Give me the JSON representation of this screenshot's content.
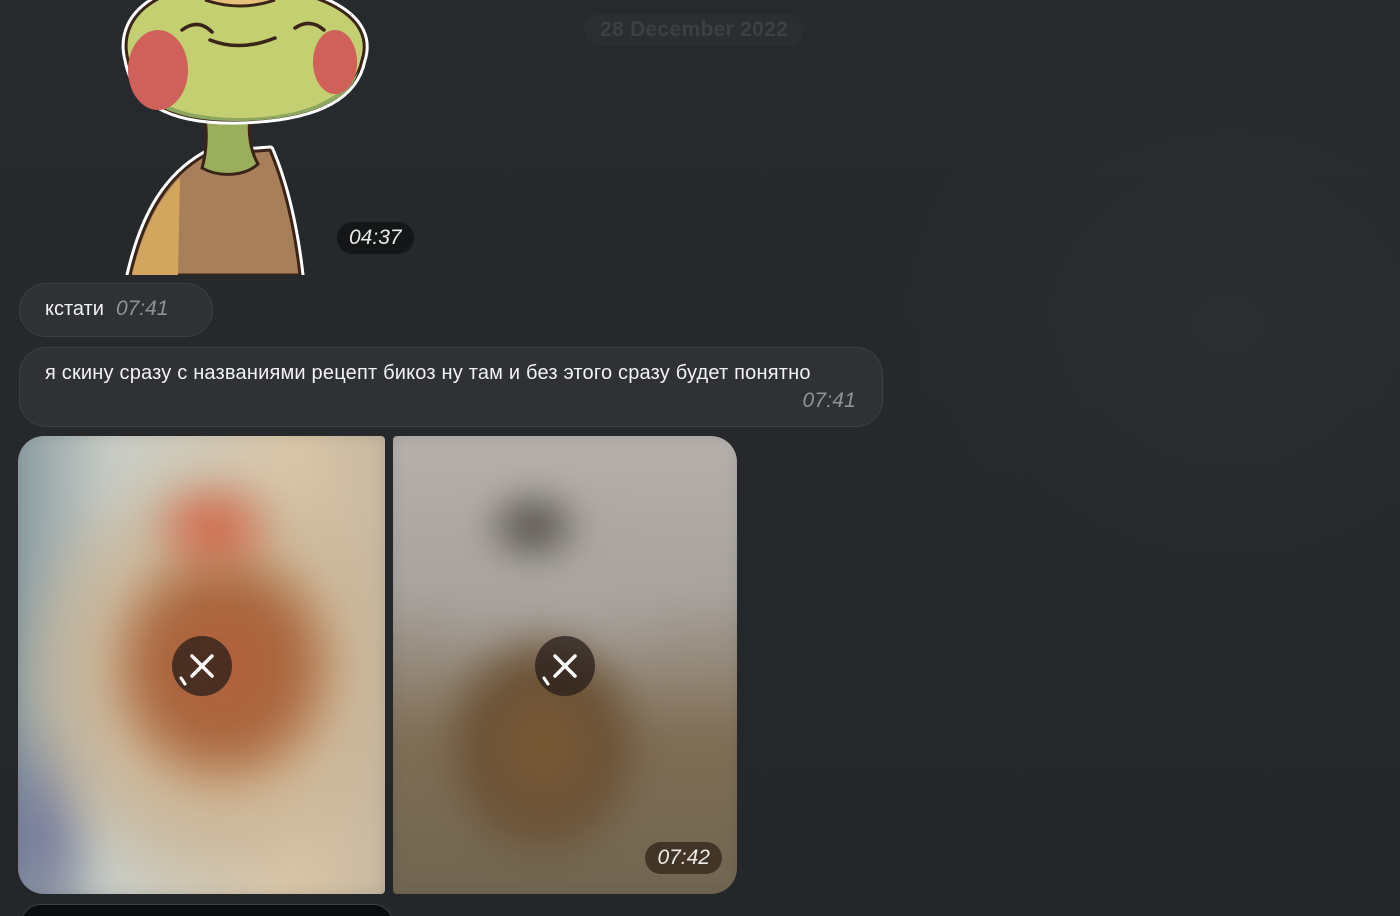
{
  "chat": {
    "date_separator": "28 December 2022",
    "messages": [
      {
        "kind": "sticker",
        "time": "04:37",
        "icon": "frog-sticker"
      },
      {
        "kind": "text",
        "text": "кстати",
        "time": "07:41"
      },
      {
        "kind": "text",
        "text": "я скину сразу с названиями рецепт бикоз ну там и без этого сразу будет понятно",
        "time": "07:41"
      },
      {
        "kind": "photo-album",
        "time": "07:42",
        "photos": [
          {
            "icon": "cancel-download-icon",
            "status": "loading"
          },
          {
            "icon": "cancel-download-icon",
            "status": "loading"
          }
        ]
      }
    ]
  },
  "colors": {
    "background": "#25272a",
    "bubble": "#2f3134",
    "bubble_border": "#3c3f43",
    "time_text": "#8c9399"
  }
}
